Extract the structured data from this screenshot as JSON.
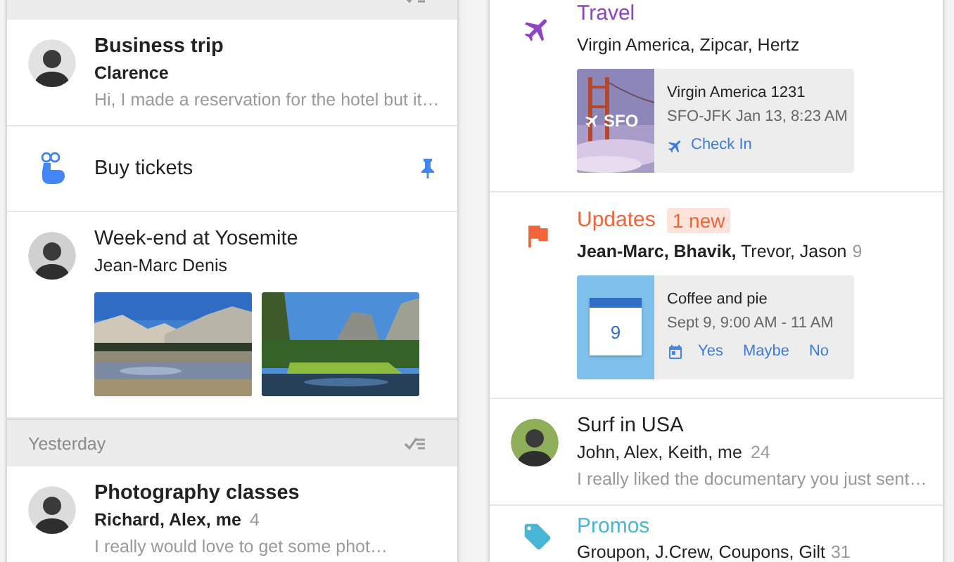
{
  "inbox": {
    "items": [
      {
        "kind": "header"
      },
      {
        "kind": "thread",
        "subject": "Business trip",
        "senders": "Clarence",
        "snippet": "Hi, I made a reservation for the hotel but it…",
        "unread": true
      },
      {
        "kind": "reminder",
        "text": "Buy tickets",
        "pinned": true
      },
      {
        "kind": "thread",
        "subject": "Week-end at Yosemite",
        "senders": "Jean-Marc Denis",
        "unread": false
      },
      {
        "kind": "header",
        "label": "Yesterday"
      },
      {
        "kind": "thread",
        "subject": "Photography classes",
        "senders": "Richard, Alex, me",
        "count": "4",
        "snippet": "I really would love to get some phot…",
        "unread": true
      }
    ]
  },
  "bundles": {
    "items": [
      {
        "kind": "travel",
        "label": "Travel",
        "color": "#8e44c4",
        "senders": "Virgin America, Zipcar, Hertz",
        "card": {
          "kind": "flight",
          "caption": "SFO",
          "title": "Virgin America 1231",
          "detail": "SFO-JFK Jan 13, 8:23 AM",
          "actions": [
            "Check In"
          ]
        }
      },
      {
        "kind": "updates",
        "label": "Updates",
        "color": "#f0643a",
        "badge": "1 new",
        "senders": "**Jean-Marc, Bhavik,** Trevor, Jason",
        "count": "9",
        "card": {
          "kind": "event",
          "day": "9",
          "title": "Coffee and pie",
          "detail": "Sept 9, 9:00 AM - 11 AM",
          "actions": [
            "Yes",
            "Maybe",
            "No"
          ]
        }
      },
      {
        "kind": "thread",
        "subject": "Surf in USA",
        "senders": "John, Alex, Keith, me",
        "count": "24",
        "snippet": "I really liked the documentary you just sent…",
        "unread": false
      },
      {
        "kind": "promos",
        "label": "Promos",
        "color": "#4ab6d6",
        "senders": "Groupon, J.Crew, Coupons, Gilt",
        "count": "31"
      }
    ]
  }
}
